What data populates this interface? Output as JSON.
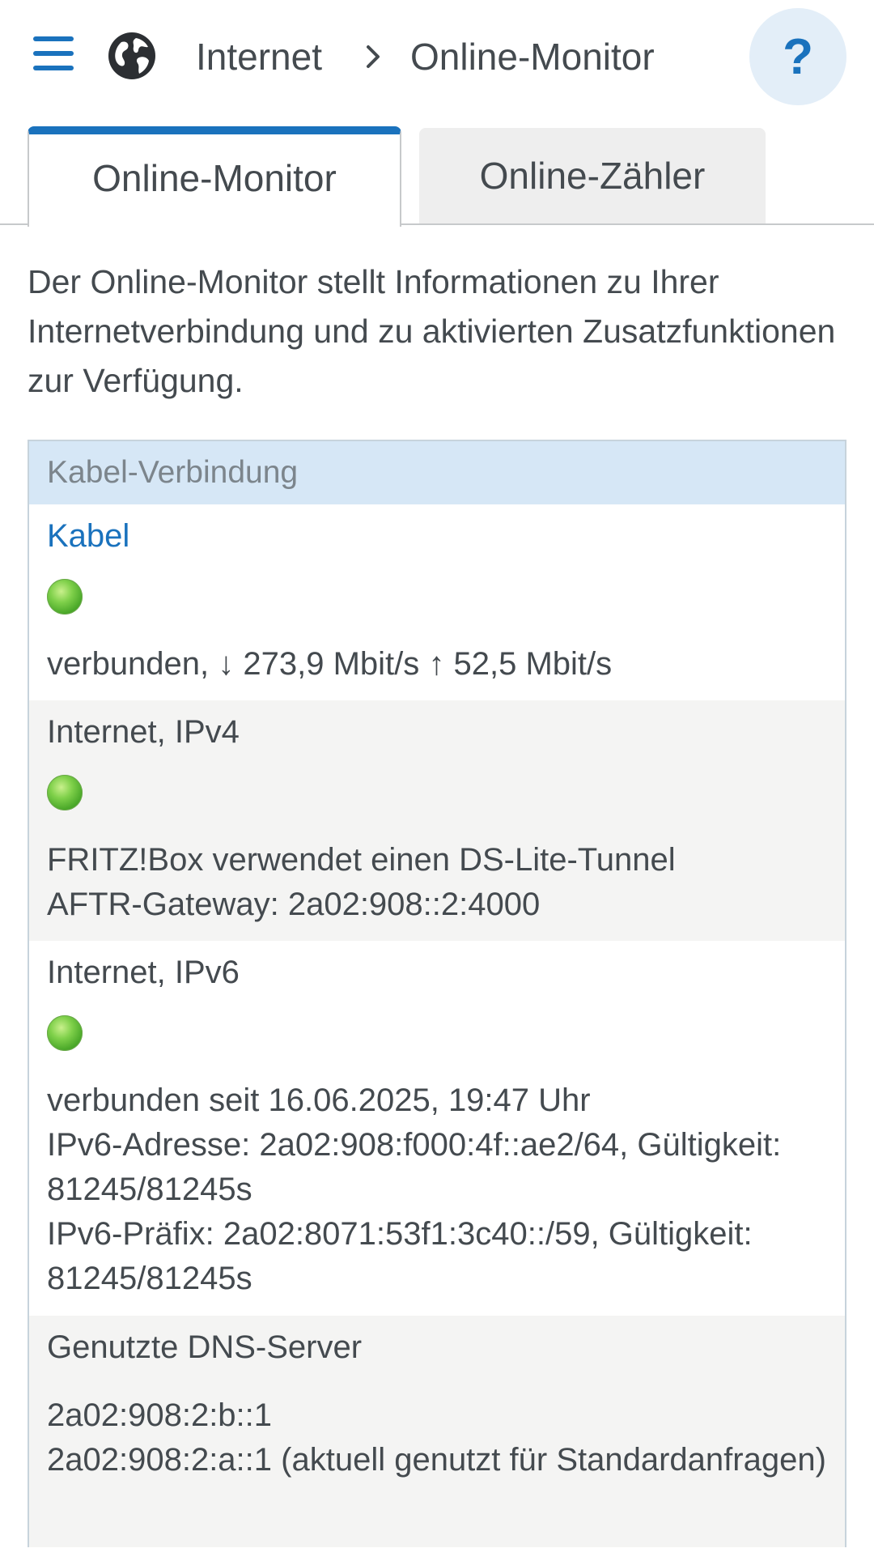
{
  "header": {
    "menu_icon": "hamburger-menu-icon",
    "section_icon": "globe-icon",
    "breadcrumb": [
      "Internet",
      "Online-Monitor"
    ],
    "help_label": "?"
  },
  "tabs": [
    {
      "label": "Online-Monitor",
      "active": true
    },
    {
      "label": "Online-Zähler",
      "active": false
    }
  ],
  "intro": "Der Online-Monitor stellt Informationen zu Ihrer Internetverbindung und zu aktivierten Zusatzfunktionen zur Verfügung.",
  "panel": {
    "title": "Kabel-Verbindung",
    "sections": [
      {
        "title": "Kabel",
        "status": "green",
        "lines": [
          "verbunden, ↓ 273,9 Mbit/s ↑ 52,5 Mbit/s"
        ]
      },
      {
        "title": "Internet, IPv4",
        "status": "green",
        "lines": [
          "FRITZ!Box verwendet einen DS-Lite-Tunnel",
          "AFTR-Gateway: 2a02:908::2:4000"
        ]
      },
      {
        "title": "Internet, IPv6",
        "status": "green",
        "lines": [
          "verbunden seit 16.06.2025, 19:47 Uhr",
          "IPv6-Adresse: 2a02:908:f000:4f::ae2/64, Gültigkeit: 81245/81245s",
          "IPv6-Präfix: 2a02:8071:53f1:3c40::/59, Gültigkeit: 81245/81245s"
        ]
      },
      {
        "title": "Genutzte DNS-Server",
        "lines": [
          "2a02:908:2:b::1",
          "2a02:908:2:a::1 (aktuell genutzt für Standardanfragen)"
        ]
      }
    ]
  },
  "colors": {
    "accent": "#1a72bd",
    "panel_header_bg": "#d6e7f6",
    "status_green": "#5bbf2e"
  }
}
